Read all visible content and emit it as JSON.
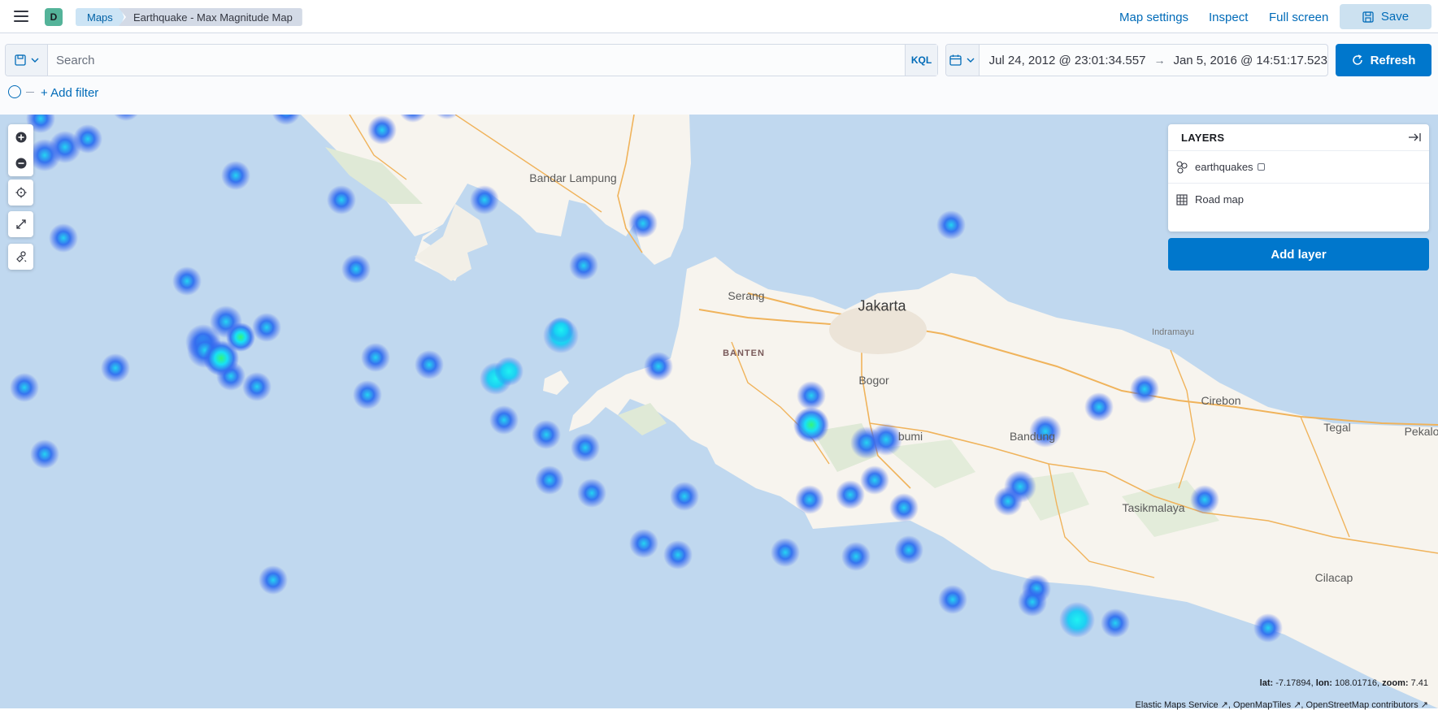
{
  "header": {
    "space_initial": "D",
    "breadcrumbs": [
      "Maps",
      "Earthquake - Max Magnitude Map"
    ],
    "links": [
      "Map settings",
      "Inspect",
      "Full screen"
    ],
    "save_label": "Save",
    "menu_icon": "hamburger-menu-icon"
  },
  "query": {
    "search_placeholder": "Search",
    "language": "KQL",
    "date_start": "Jul 24, 2012 @ 23:01:34.557",
    "date_arrow": "→",
    "date_end": "Jan 5, 2016 @ 14:51:17.523",
    "refresh_label": "Refresh",
    "add_filter_label": "+ Add filter"
  },
  "map": {
    "places": {
      "bandar_lampung": "Bandar Lampung",
      "serang": "Serang",
      "jakarta": "Jakarta",
      "banten": "BANTEN",
      "bogor": "Bogor",
      "indramayu": "Indramayu",
      "cirebon": "Cirebon",
      "tegal": "Tegal",
      "pekalongan": "Pekalo",
      "bandung": "Bandung",
      "sukabumi": "bumi",
      "tasikmalaya": "Tasikmalaya",
      "cilacap": "Cilacap"
    },
    "controls": [
      "zoom-in-icon",
      "zoom-out-icon",
      "reset-view-icon",
      "fit-bounds-icon",
      "draw-tool-icon"
    ],
    "layers_title": "LAYERS",
    "layers": [
      {
        "name": "earthquakes",
        "icon": "heatmap-icon"
      },
      {
        "name": "Road map",
        "icon": "grid-tile-icon"
      }
    ],
    "add_layer_label": "Add layer",
    "coords": {
      "lat_label": "lat:",
      "lat": "-7.17894",
      "lon_label": "lon:",
      "lon": "108.01716",
      "zoom_label": "zoom:",
      "zoom": "7.41"
    },
    "attribution": [
      "Elastic Maps Service",
      "OpenMapTiles",
      "OpenStreetMap contributors"
    ],
    "colors": {
      "water": "#c0d8ef",
      "land": "#f7f4ee",
      "road": "#f0b35b",
      "heat_low": "#2b6cf0",
      "heat_mid": "#19e0f5",
      "heat_high": "#35f57a",
      "accent": "#0077cc"
    }
  }
}
